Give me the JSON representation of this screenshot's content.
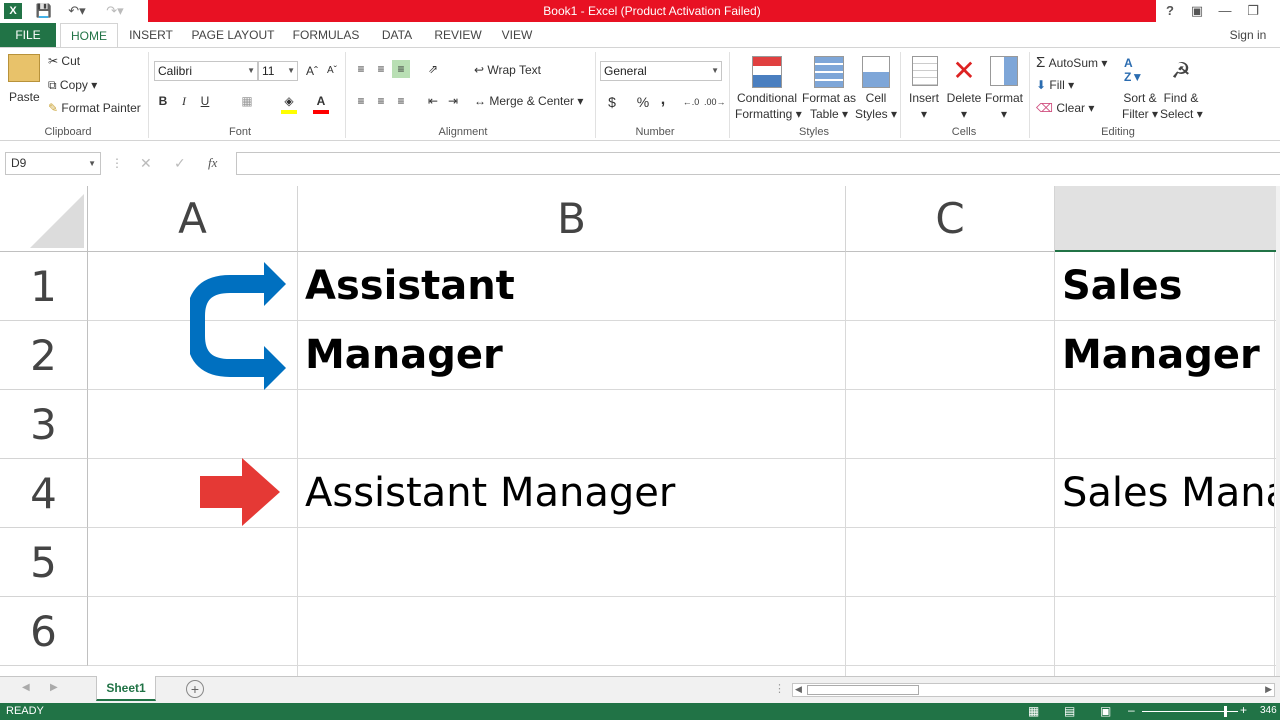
{
  "window": {
    "title": "Book1 -  Excel (Product Activation Failed)",
    "help": "?",
    "signin": "Sign in"
  },
  "tabs": [
    "FILE",
    "HOME",
    "INSERT",
    "PAGE LAYOUT",
    "FORMULAS",
    "DATA",
    "REVIEW",
    "VIEW"
  ],
  "ribbon": {
    "clipboard": {
      "label": "Clipboard",
      "paste": "Paste",
      "cut": "Cut",
      "copy": "Copy",
      "format_painter": "Format Painter"
    },
    "font": {
      "label": "Font",
      "name": "Calibri",
      "size": "11",
      "bold": "B",
      "italic": "I",
      "underline": "U"
    },
    "alignment": {
      "label": "Alignment",
      "wrap": "Wrap Text",
      "merge": "Merge & Center"
    },
    "number": {
      "label": "Number",
      "format": "General",
      "currency": "$",
      "percent": "%",
      "comma": ","
    },
    "styles": {
      "label": "Styles",
      "conditional_1": "Conditional",
      "conditional_2": "Formatting",
      "format_table_1": "Format as",
      "format_table_2": "Table",
      "cell_styles_1": "Cell",
      "cell_styles_2": "Styles"
    },
    "cells": {
      "label": "Cells",
      "insert": "Insert",
      "delete": "Delete",
      "format": "Format"
    },
    "editing": {
      "label": "Editing",
      "autosum": "AutoSum",
      "fill": "Fill",
      "clear": "Clear",
      "sort_1": "Sort &",
      "sort_2": "Filter",
      "find_1": "Find &",
      "find_2": "Select"
    }
  },
  "formula_bar": {
    "name_box": "D9",
    "fx": "fx",
    "value": ""
  },
  "columns": [
    "A",
    "B",
    "C",
    ""
  ],
  "rows": [
    "1",
    "2",
    "3",
    "4",
    "5",
    "6"
  ],
  "cells": {
    "B1": "Assistant",
    "B2": "Manager",
    "B4": "Assistant Manager",
    "D1": "Sales",
    "D2": "Manager",
    "D4": "Sales Mana"
  },
  "sheets": {
    "active": "Sheet1"
  },
  "status": {
    "mode": "READY",
    "zoom": "346"
  },
  "colors": {
    "excel_green": "#217346",
    "title_red": "#e81123",
    "arrow_blue": "#0070c0",
    "arrow_red": "#e53935"
  }
}
